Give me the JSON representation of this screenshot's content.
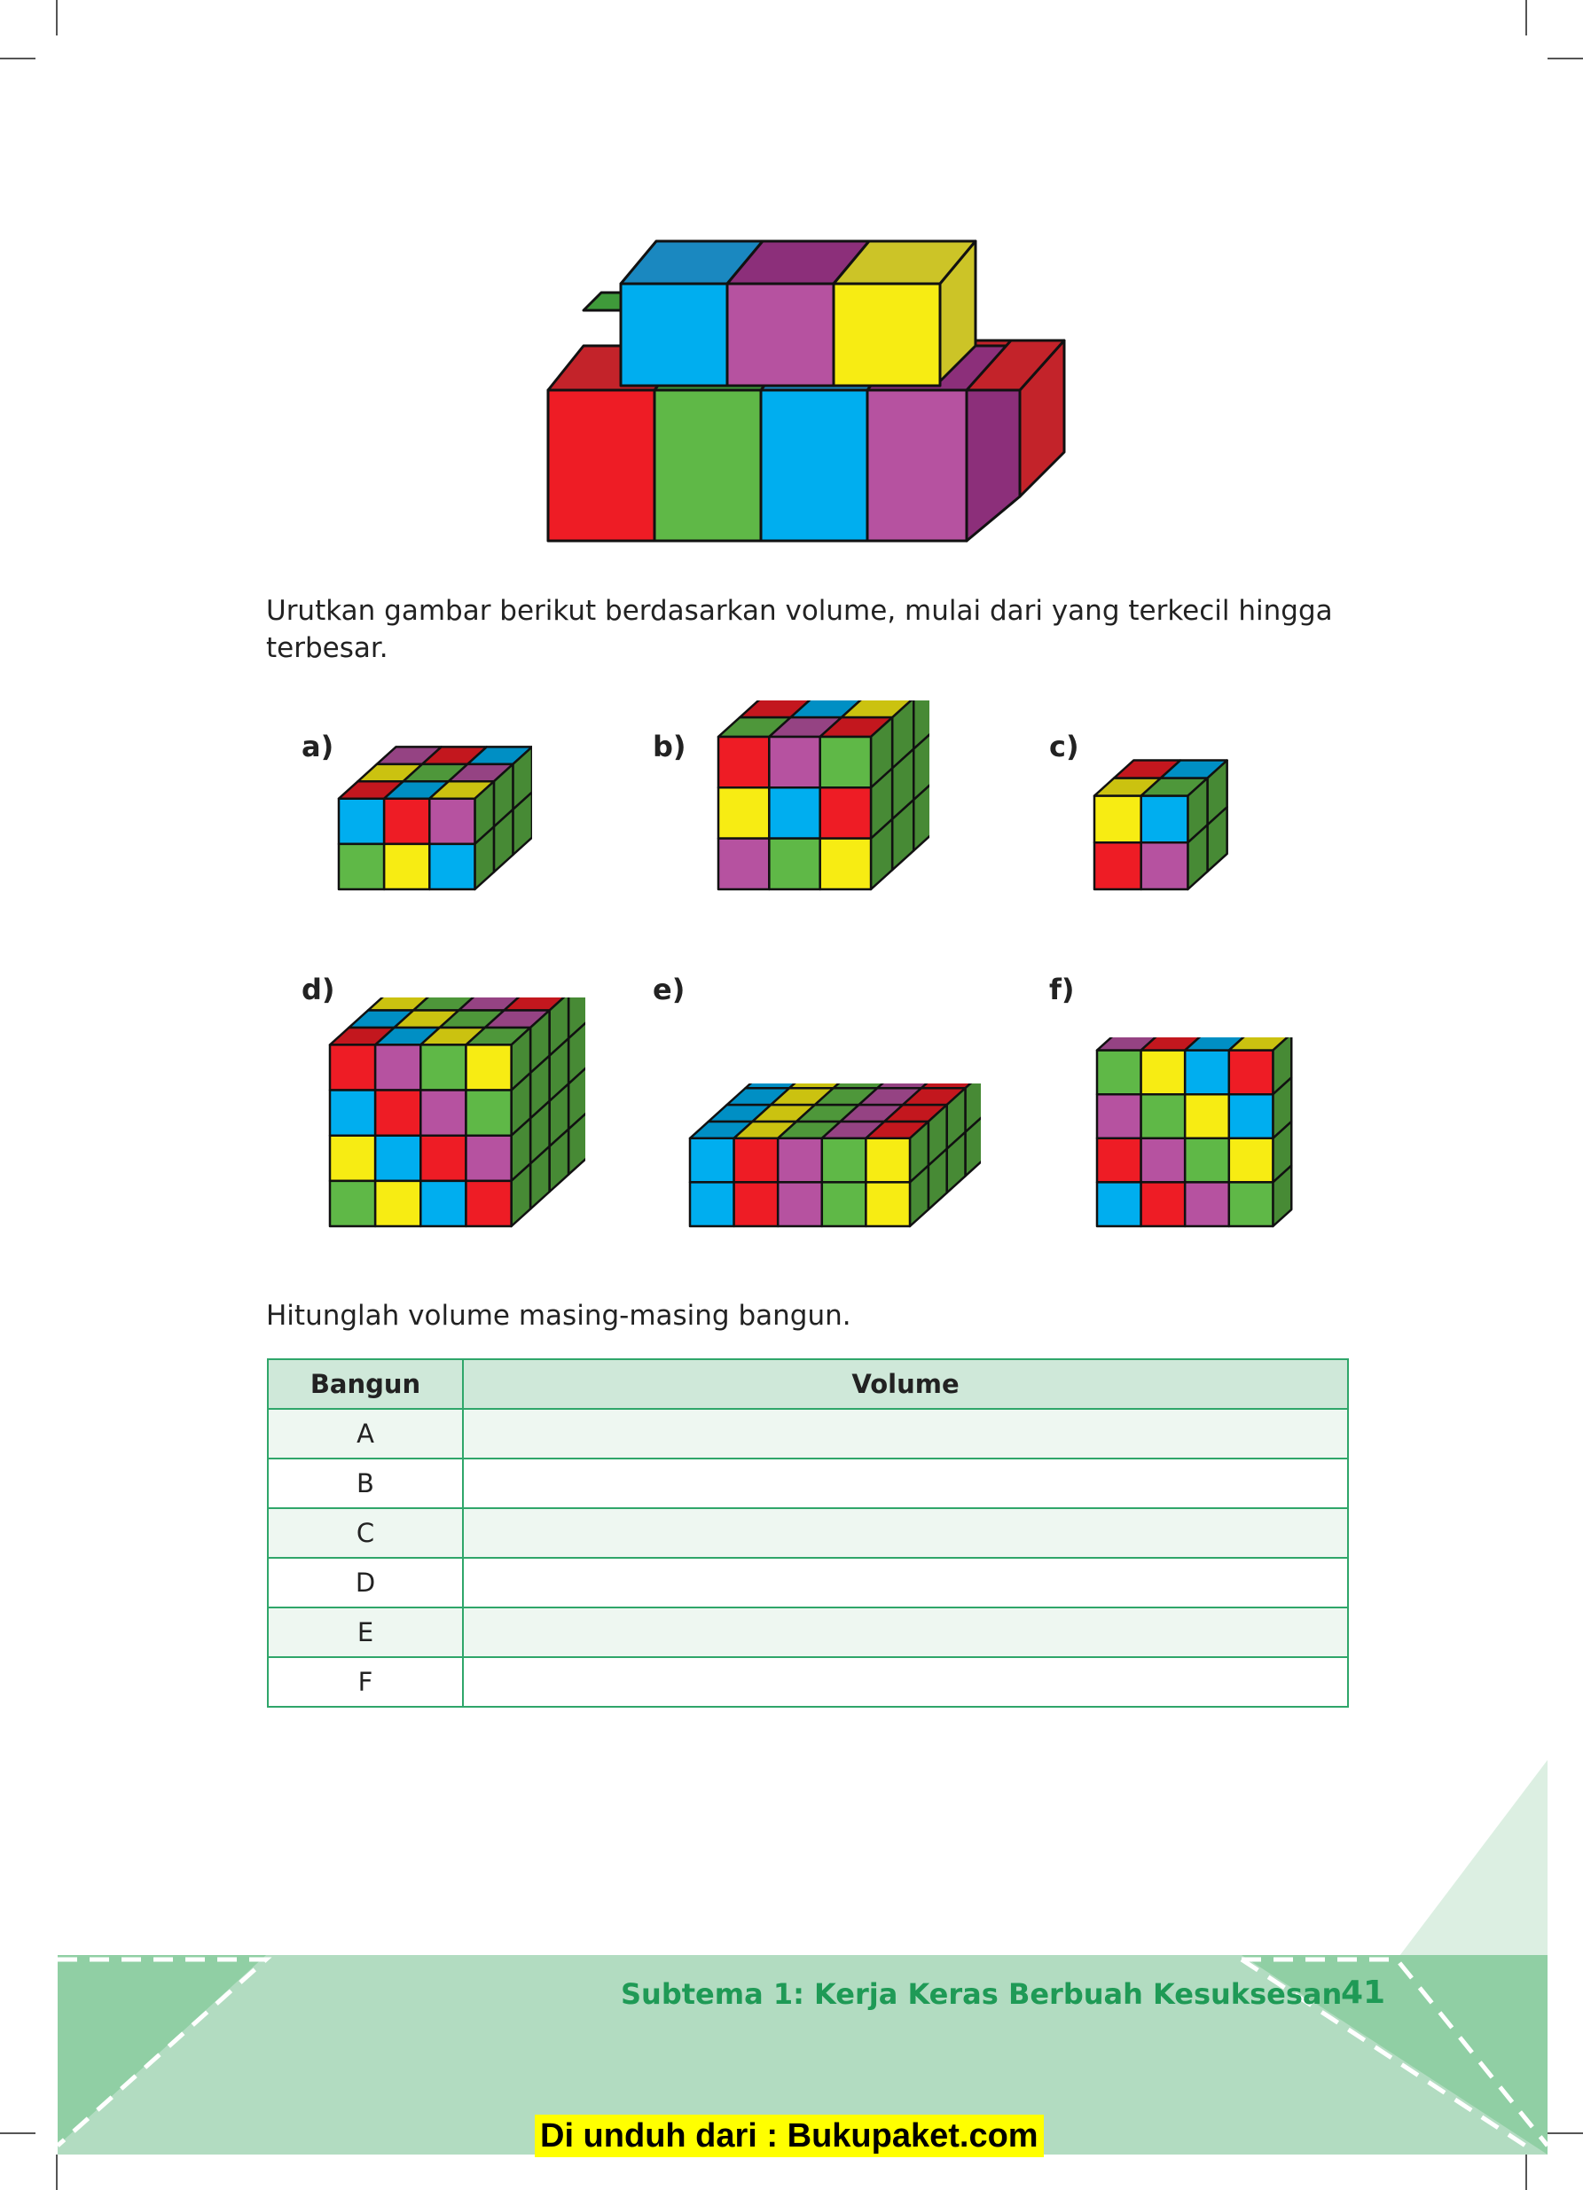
{
  "instructions": {
    "order_text_line1": "Urutkan gambar berikut berdasarkan volume, mulai dari yang terkecil hingga",
    "order_text_line2": "terbesar.",
    "compute_text": "Hitunglah volume masing-masing bangun."
  },
  "figures": [
    {
      "label": "a)",
      "dims": {
        "w": 3,
        "d": 3,
        "h": 2
      }
    },
    {
      "label": "b)",
      "dims": {
        "w": 3,
        "d": 3,
        "h": 3
      }
    },
    {
      "label": "c)",
      "dims": {
        "w": 2,
        "d": 2,
        "h": 2
      }
    },
    {
      "label": "d)",
      "dims": {
        "w": 4,
        "d": 4,
        "h": 4
      }
    },
    {
      "label": "e)",
      "dims": {
        "w": 5,
        "d": 4,
        "h": 2
      }
    },
    {
      "label": "f)",
      "dims": {
        "w": 4,
        "d": 1,
        "h": 4
      }
    }
  ],
  "table": {
    "headers": [
      "Bangun",
      "Volume"
    ],
    "rows": [
      {
        "bangun": "A",
        "volume": ""
      },
      {
        "bangun": "B",
        "volume": ""
      },
      {
        "bangun": "C",
        "volume": ""
      },
      {
        "bangun": "D",
        "volume": ""
      },
      {
        "bangun": "E",
        "volume": ""
      },
      {
        "bangun": "F",
        "volume": ""
      }
    ]
  },
  "footer": {
    "subtema": "Subtema 1: Kerja Keras Berbuah Kesuksesan",
    "page_number": "41",
    "download_note": "Di unduh dari : Bukupaket.com"
  },
  "colors": {
    "cube_red": "#ee1c25",
    "cube_green": "#5fb847",
    "cube_blue": "#00aeef",
    "cube_purple": "#b652a0",
    "cube_yellow": "#f7ec13",
    "table_border": "#2fa66a",
    "footer_green": "#1f9a56",
    "footer_band": "#b2dcc1"
  }
}
